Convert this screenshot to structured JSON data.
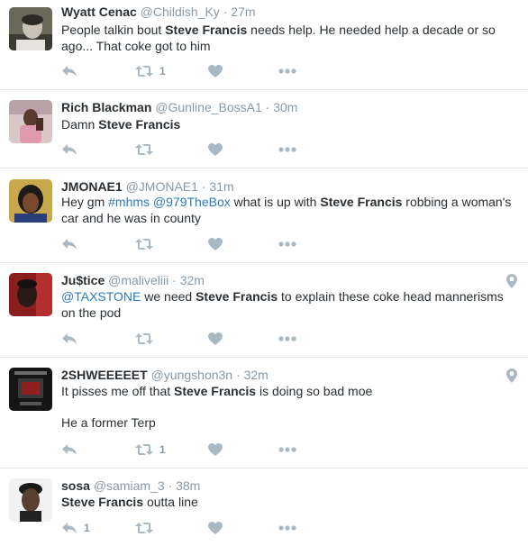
{
  "colors": {
    "name": "#292f33",
    "meta": "#8899a6",
    "link": "#2b7bb9",
    "icon": "#aab8c2",
    "divider": "#e1e8ed"
  },
  "tweets": [
    {
      "name": "Wyatt Cenac",
      "handle": "@Childish_Ky",
      "time": "27m",
      "text": {
        "t1": "People talkin bout ",
        "b1": "Steve Francis",
        "t2": " needs help. He needed help a decade or so ago... That coke got to him"
      },
      "retweet_count": "1",
      "like_count": "",
      "reply_count": "",
      "has_geo": false,
      "avatar_icon": "avatar-photo"
    },
    {
      "name": "Rich Blackman",
      "handle": "@Gunline_BossA1",
      "time": "30m",
      "text": {
        "t1": "Damn ",
        "b1": "Steve Francis"
      },
      "retweet_count": "",
      "like_count": "",
      "reply_count": "",
      "has_geo": false,
      "avatar_icon": "avatar-photo"
    },
    {
      "name": "JMONAE1",
      "handle": "@JMONAE1",
      "time": "31m",
      "text": {
        "t1": "Hey gm ",
        "l1": "#mhms",
        "t2": " ",
        "l2": "@979TheBox",
        "t3": " what is up with ",
        "b1": "Steve Francis",
        "t4": " robbing a woman's car and he was in county"
      },
      "retweet_count": "",
      "like_count": "",
      "reply_count": "",
      "has_geo": false,
      "avatar_icon": "avatar-photo"
    },
    {
      "name": "Ju$tice",
      "handle": "@maliveliii",
      "time": "32m",
      "text": {
        "l1": "@TAXSTONE",
        "t1": " we need ",
        "b1": "Steve Francis",
        "t2": " to explain these coke head mannerisms on the pod"
      },
      "retweet_count": "",
      "like_count": "",
      "reply_count": "",
      "has_geo": true,
      "avatar_icon": "avatar-photo"
    },
    {
      "name": "2SHWEEEEET",
      "handle": "@yungshon3n",
      "time": "32m",
      "text": {
        "t1": "It pisses me off that ",
        "b1": "Steve Francis",
        "t2": " is doing so bad moe",
        "p2": "He a former Terp"
      },
      "retweet_count": "1",
      "like_count": "",
      "reply_count": "",
      "has_geo": true,
      "avatar_icon": "avatar-photo"
    },
    {
      "name": "sosa",
      "handle": "@samiam_3",
      "time": "38m",
      "text": {
        "b1": "Steve Francis",
        "t1": " outta line"
      },
      "retweet_count": "",
      "like_count": "",
      "reply_count": "1",
      "has_geo": false,
      "avatar_icon": "avatar-photo"
    }
  ],
  "separator": "·"
}
